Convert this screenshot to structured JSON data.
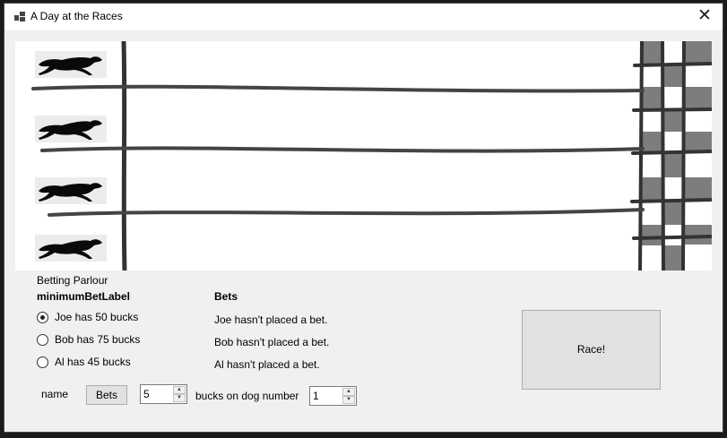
{
  "window": {
    "title": "A Day at the Races",
    "close_glyph": "✕"
  },
  "track": {
    "dog_count": 4
  },
  "betting": {
    "group_label": "Betting Parlour",
    "minimum_bet_label": "minimumBetLabel",
    "radios": [
      {
        "label": "Joe has 50 bucks",
        "checked": true
      },
      {
        "label": "Bob has 75 bucks",
        "checked": false
      },
      {
        "label": "Al has 45 bucks",
        "checked": false
      }
    ],
    "bets_heading": "Bets",
    "bets": [
      "Joe hasn't placed a bet.",
      "Bob hasn't placed a bet.",
      "Al hasn't placed a bet."
    ],
    "name_label": "name",
    "bets_button": "Bets",
    "amount_value": "5",
    "bucks_label": "bucks on dog number",
    "dog_number_value": "1",
    "race_button": "Race!"
  }
}
